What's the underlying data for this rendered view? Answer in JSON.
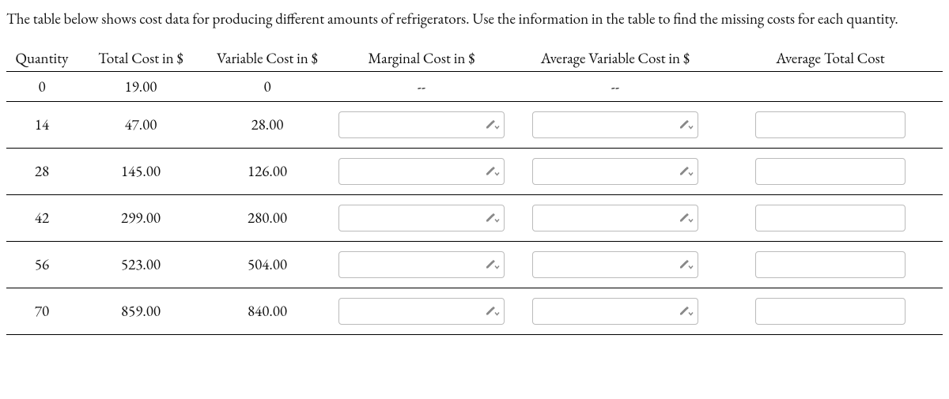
{
  "instructions": "The table below shows cost data for producing different amounts of refrigerators. Use the information in the table to find the missing costs for each quantity.",
  "headers": {
    "quantity": "Quantity",
    "total_cost": "Total Cost in $",
    "variable_cost": "Variable Cost in $",
    "marginal_cost": "Marginal Cost in $",
    "avg_variable_cost": "Average Variable Cost in $",
    "avg_total_cost": "Average Total Cost"
  },
  "rows": [
    {
      "quantity": "0",
      "total_cost": "19.00",
      "variable_cost": "0",
      "marginal_cost": "--",
      "avg_variable_cost": "--",
      "avg_total_cost_input": false
    },
    {
      "quantity": "14",
      "total_cost": "47.00",
      "variable_cost": "28.00",
      "avg_total_cost_input": true
    },
    {
      "quantity": "28",
      "total_cost": "145.00",
      "variable_cost": "126.00",
      "avg_total_cost_input": true
    },
    {
      "quantity": "42",
      "total_cost": "299.00",
      "variable_cost": "280.00",
      "avg_total_cost_input": true
    },
    {
      "quantity": "56",
      "total_cost": "523.00",
      "variable_cost": "504.00",
      "avg_total_cost_input": true
    },
    {
      "quantity": "70",
      "total_cost": "859.00",
      "variable_cost": "840.00",
      "avg_total_cost_input": true
    }
  ],
  "chart_data": {
    "type": "table",
    "title": "Refrigerator production cost data",
    "columns": [
      "Quantity",
      "Total Cost in $",
      "Variable Cost in $",
      "Marginal Cost in $",
      "Average Variable Cost in $",
      "Average Total Cost"
    ],
    "data": [
      [
        0,
        19.0,
        0,
        null,
        null,
        null
      ],
      [
        14,
        47.0,
        28.0,
        null,
        null,
        null
      ],
      [
        28,
        145.0,
        126.0,
        null,
        null,
        null
      ],
      [
        42,
        299.0,
        280.0,
        null,
        null,
        null
      ],
      [
        56,
        523.0,
        504.0,
        null,
        null,
        null
      ],
      [
        70,
        859.0,
        840.0,
        null,
        null,
        null
      ]
    ]
  }
}
